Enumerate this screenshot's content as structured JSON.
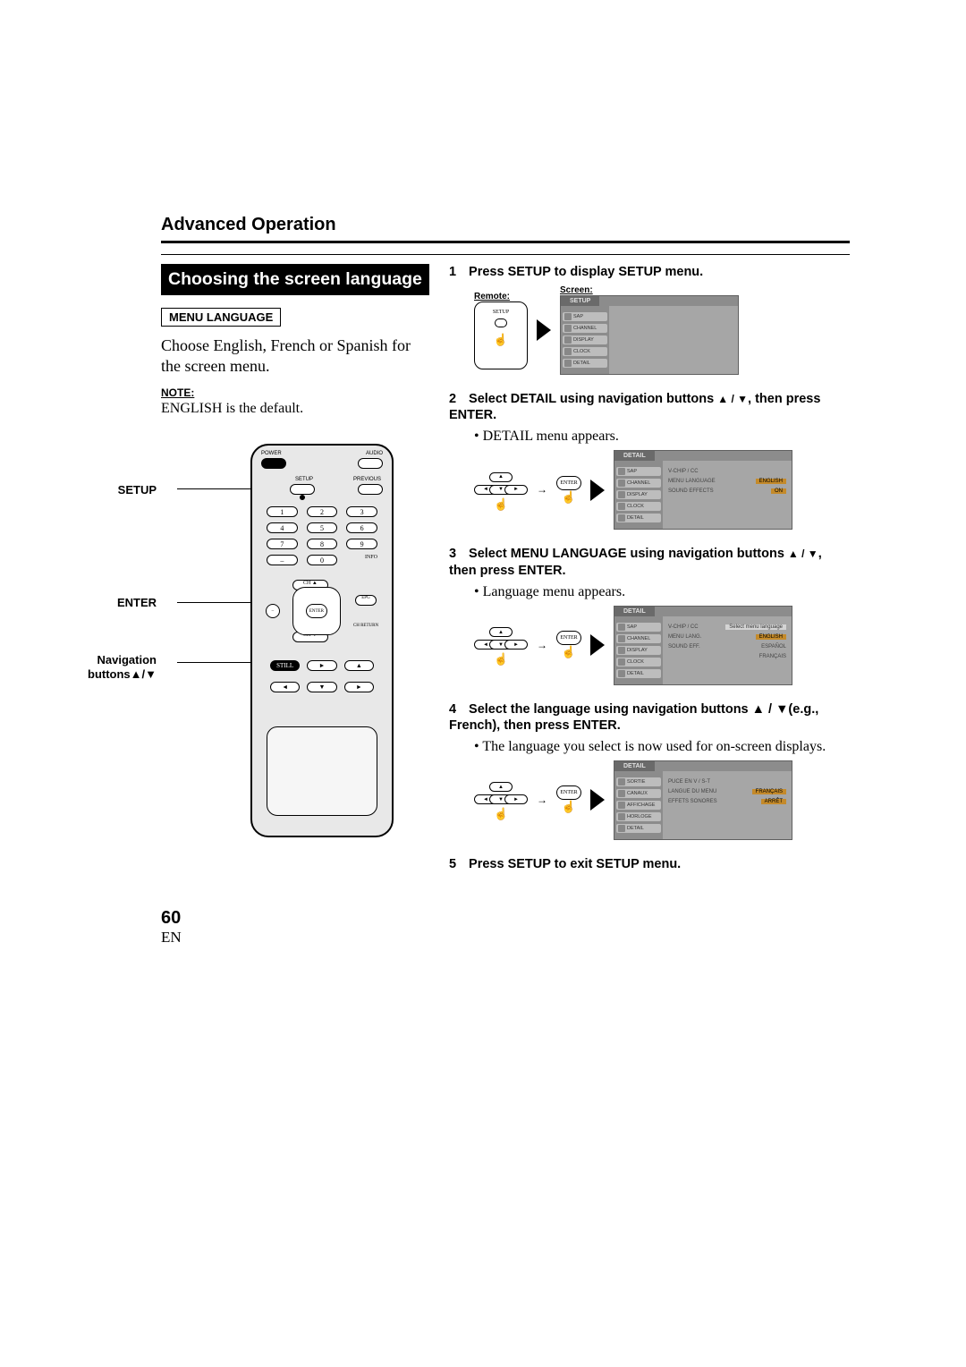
{
  "header": {
    "section": "Advanced Operation"
  },
  "title": "Choosing the screen language",
  "left": {
    "subhead": "MENU LANGUAGE",
    "intro": "Choose English, French or Spanish for the screen menu.",
    "note_label": "NOTE:",
    "note_text": "ENGLISH is the default.",
    "remote_labels": {
      "setup": "SETUP",
      "enter": "ENTER",
      "nav1": "Navigation",
      "nav2": "buttons▲/▼"
    },
    "remote": {
      "power": "POWER",
      "audio": "AUDIO",
      "setup": "SETUP",
      "previous": "PREVIOUS",
      "info": "INFO",
      "ch_up": "CH ▲",
      "ch_dn": "CH ▼",
      "enter": "ENTER",
      "epg": "EPG",
      "ch_return": "CH RETURN",
      "still": "STILL",
      "keys": [
        "1",
        "2",
        "3",
        "4",
        "5",
        "6",
        "7",
        "8",
        "9",
        "–",
        "0"
      ]
    }
  },
  "steps": [
    {
      "num": "1",
      "text": "Press SETUP to display SETUP menu.",
      "remote_caption": "Remote:",
      "screen_caption": "Screen:",
      "screen": {
        "tab": "SETUP",
        "sidebar": [
          "SAP",
          "CHANNEL",
          "DISPLAY",
          "CLOCK",
          "DETAIL"
        ]
      }
    },
    {
      "num": "2",
      "text_a": "Select DETAIL using navigation buttons ",
      "text_b": ", then press ENTER.",
      "updown": "▲ / ▼",
      "bullet": "DETAIL menu appears.",
      "enter": "ENTER",
      "screen": {
        "tab": "DETAIL",
        "sidebar": [
          "SAP",
          "CHANNEL",
          "DISPLAY",
          "CLOCK",
          "DETAIL"
        ],
        "rows": [
          {
            "k": "V-CHIP / CC",
            "v": ""
          },
          {
            "k": "MENU LANGUAGE",
            "v": "ENGLISH",
            "hl": true
          },
          {
            "k": "SOUND EFFECTS",
            "v": "ON",
            "hl": true
          }
        ]
      }
    },
    {
      "num": "3",
      "text_a": "Select MENU LANGUAGE using navigation buttons ",
      "text_b": ", then press ENTER.",
      "updown": "▲ / ▼",
      "bullet": "Language menu appears.",
      "enter": "ENTER",
      "screen": {
        "tab": "DETAIL",
        "sidebar": [
          "SAP",
          "CHANNEL",
          "DISPLAY",
          "CLOCK",
          "DETAIL"
        ],
        "helper": "Select menu language",
        "rows": [
          {
            "k": "V-CHIP / CC",
            "v": ""
          },
          {
            "k": "MENU LANG.",
            "v": "ENGLISH",
            "hl": true
          },
          {
            "k": "SOUND EFF.",
            "v": "ESPAÑOL"
          },
          {
            "k": "",
            "v": "FRANÇAIS"
          }
        ]
      }
    },
    {
      "num": "4",
      "text_full": "Select the language using navigation buttons ▲ / ▼(e.g., French), then press ENTER.",
      "bullet": "The language you select is now used for on-screen displays.",
      "enter": "ENTER",
      "screen": {
        "tab": "DETAIL",
        "sidebar": [
          "SORTIE",
          "CANAUX",
          "AFFICHAGE",
          "HORLOGE",
          "DETAIL"
        ],
        "rows": [
          {
            "k": "PUCE EN V / S-T",
            "v": ""
          },
          {
            "k": "LANGUE DU MENU",
            "v": "FRANÇAIS",
            "hl": true
          },
          {
            "k": "EFFETS SONORES",
            "v": "ARRÊT",
            "hl": true
          }
        ]
      }
    },
    {
      "num": "5",
      "text": "Press SETUP to exit SETUP menu."
    }
  ],
  "footer": {
    "page": "60",
    "lang": "EN"
  }
}
